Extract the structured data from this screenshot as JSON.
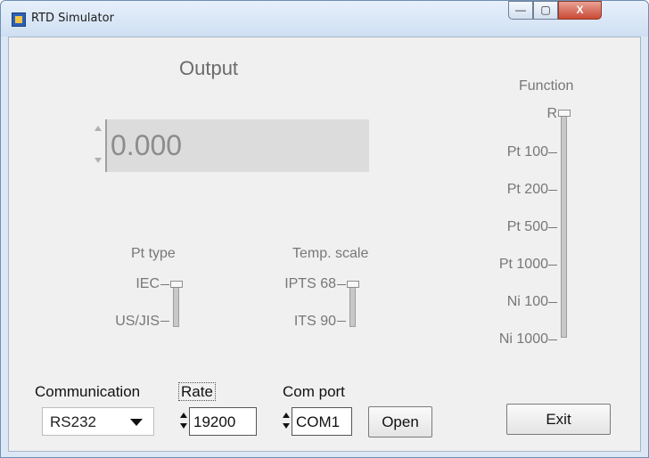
{
  "window": {
    "title": "RTD Simulator",
    "controls": {
      "minimize": "—",
      "maximize": "▢",
      "close": "X"
    }
  },
  "output": {
    "title": "Output",
    "value": "0.000"
  },
  "pt_type": {
    "title": "Pt type",
    "options": [
      "IEC",
      "US/JIS"
    ],
    "selected": "IEC"
  },
  "temp_scale": {
    "title": "Temp. scale",
    "options": [
      "IPTS 68",
      "ITS 90"
    ],
    "selected": "IPTS 68"
  },
  "function": {
    "title": "Function",
    "options": [
      "R",
      "Pt 100",
      "Pt 200",
      "Pt 500",
      "Pt 1000",
      "Ni 100",
      "Ni 1000"
    ],
    "selected": "R"
  },
  "communication": {
    "label": "Communication",
    "value": "RS232"
  },
  "rate": {
    "label": "Rate",
    "value": "19200"
  },
  "com_port": {
    "label": "Com port",
    "value": "COM1"
  },
  "buttons": {
    "open": "Open",
    "exit": "Exit"
  }
}
